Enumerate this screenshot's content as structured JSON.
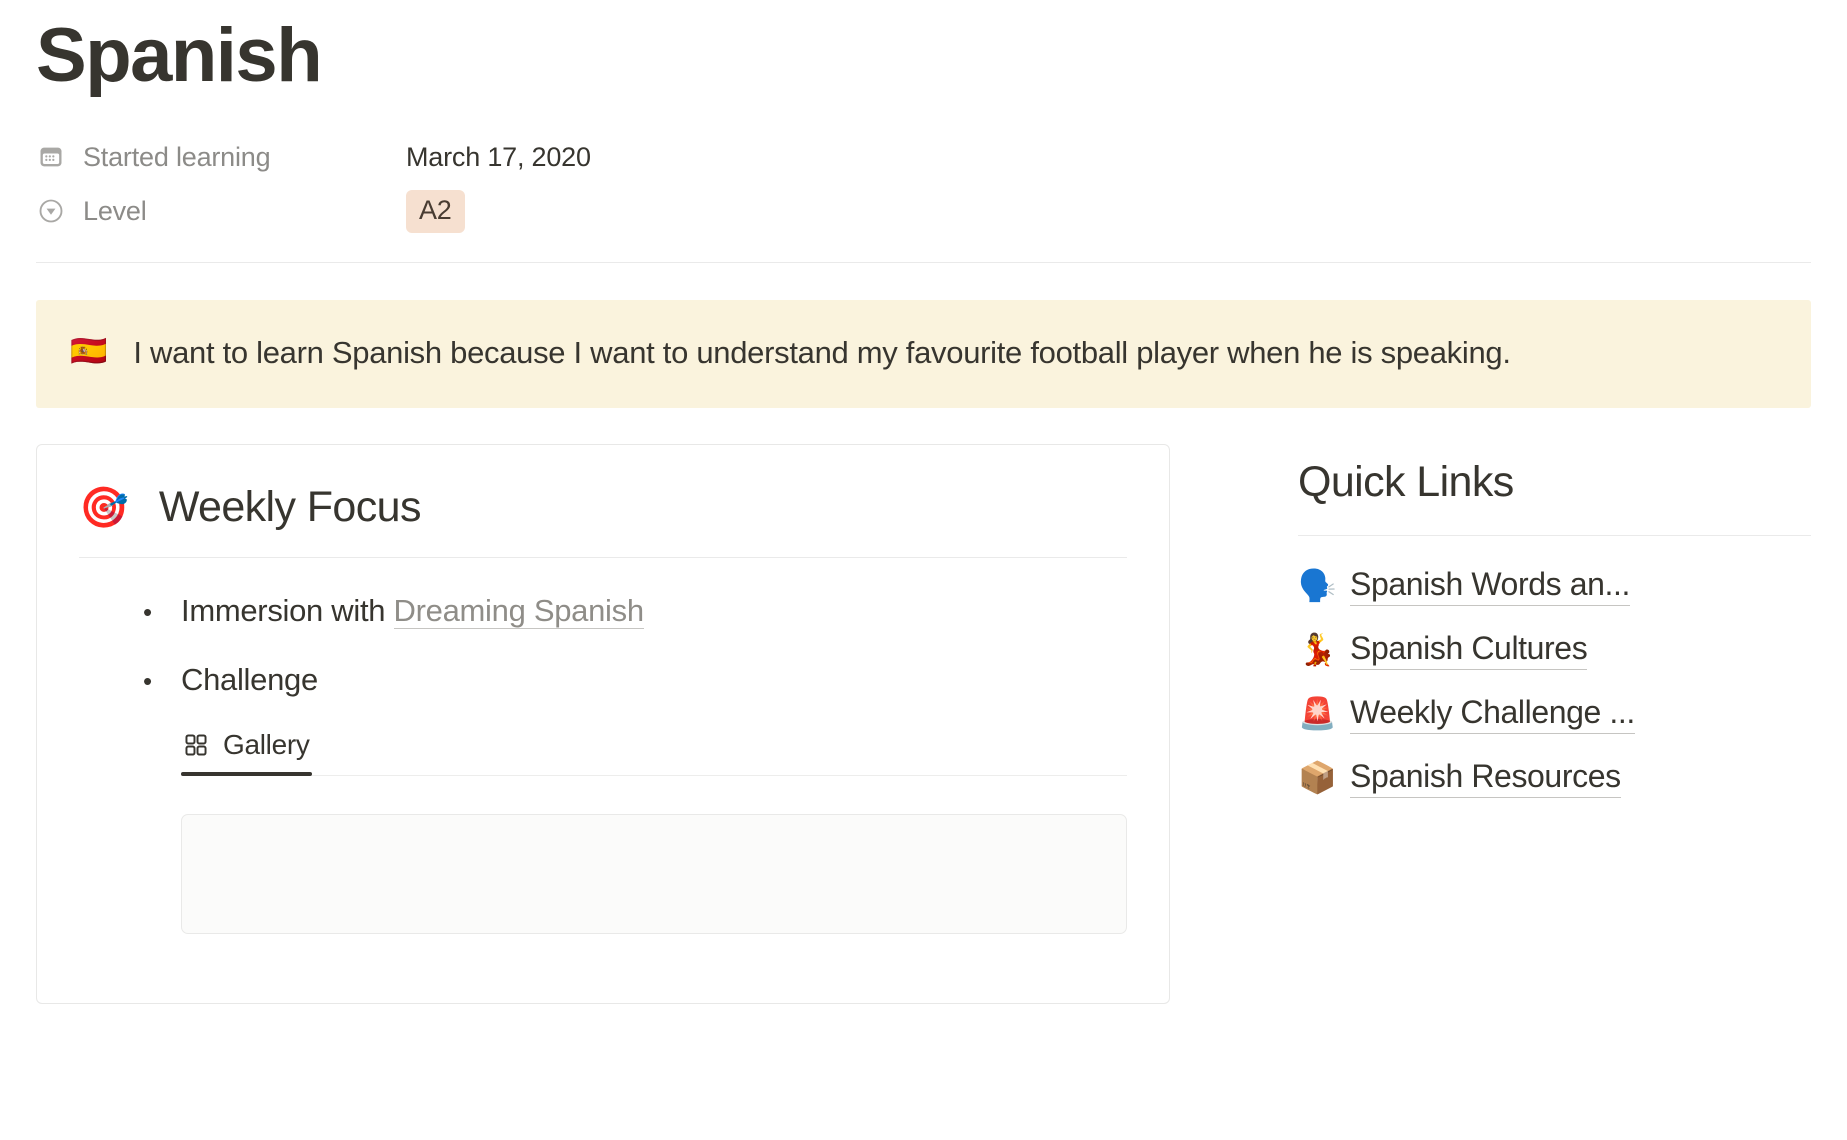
{
  "page": {
    "title": "Spanish"
  },
  "properties": [
    {
      "icon": "calendar-icon",
      "label": "Started learning",
      "value": "March 17, 2020",
      "type": "date"
    },
    {
      "icon": "select-circle-chevron-icon",
      "label": "Level",
      "value": "A2",
      "type": "select",
      "badge_bg": "#f6e0d0",
      "badge_fg": "#493c32"
    }
  ],
  "callout": {
    "emoji": "🇪🇸",
    "emoji_name": "flag-spain",
    "text": "I want to learn Spanish because I want to understand my favourite football player when he is speaking.",
    "background": "#faf3dd"
  },
  "weekly_focus": {
    "emoji": "🎯",
    "emoji_name": "direct-hit-target",
    "title": "Weekly Focus",
    "bullets": [
      {
        "text_before": "Immersion with ",
        "link_text": "Dreaming Spanish",
        "text_after": ""
      },
      {
        "text_before": "Challenge",
        "link_text": "",
        "text_after": ""
      }
    ],
    "tabs": [
      {
        "label": "Gallery",
        "icon": "grid-2x2-icon",
        "active": true
      }
    ]
  },
  "quick_links": {
    "title": "Quick Links",
    "items": [
      {
        "emoji": "🗣️",
        "emoji_name": "speaking-head",
        "label": "Spanish Words an..."
      },
      {
        "emoji": "💃",
        "emoji_name": "dancer",
        "label": "Spanish Cultures"
      },
      {
        "emoji": "🚨",
        "emoji_name": "police-car-light",
        "label": "Weekly Challenge ..."
      },
      {
        "emoji": "📦",
        "emoji_name": "package-box",
        "label": "Spanish Resources"
      }
    ]
  }
}
